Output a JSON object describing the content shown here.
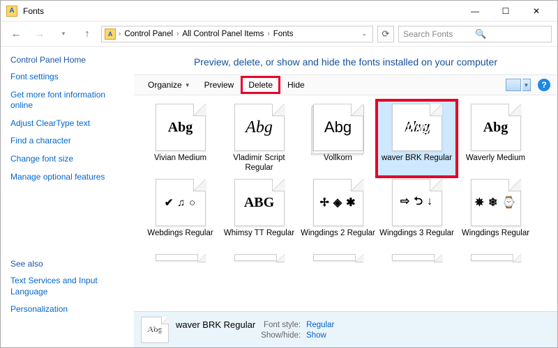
{
  "window": {
    "title": "Fonts"
  },
  "breadcrumb": {
    "items": [
      "Control Panel",
      "All Control Panel Items",
      "Fonts"
    ]
  },
  "search": {
    "placeholder": "Search Fonts"
  },
  "sidebar": {
    "home": "Control Panel Home",
    "links": [
      "Font settings",
      "Get more font information online",
      "Adjust ClearType text",
      "Find a character",
      "Change font size",
      "Manage optional features"
    ],
    "see_also_heading": "See also",
    "see_also": [
      "Text Services and Input Language",
      "Personalization"
    ]
  },
  "page_title": "Preview, delete, or show and hide the fonts installed on your computer",
  "toolbar": {
    "organize": "Organize",
    "preview": "Preview",
    "delete": "Delete",
    "hide": "Hide"
  },
  "fonts": [
    {
      "name": "Vivian Medium",
      "sample": "Abg",
      "style": "serif",
      "stack": false
    },
    {
      "name": "Vladimir Script Regular",
      "sample": "Abg",
      "style": "script",
      "stack": false
    },
    {
      "name": "Vollkorn",
      "sample": "Abg",
      "style": "sans",
      "stack": true
    },
    {
      "name": "waver BRK Regular",
      "sample": "Abg",
      "style": "zebra",
      "stack": false,
      "selected": true,
      "highlight": true
    },
    {
      "name": "Waverly Medium",
      "sample": "Abg",
      "style": "serif",
      "stack": false
    },
    {
      "name": "Webdings Regular",
      "sample": "✔ ♫ ○",
      "style": "symbols",
      "stack": false
    },
    {
      "name": "Whimsy TT Regular",
      "sample": "ABG",
      "style": "serif",
      "stack": false
    },
    {
      "name": "Wingdings 2 Regular",
      "sample": "✢ ◈ ✱",
      "style": "wing",
      "stack": false
    },
    {
      "name": "Wingdings 3 Regular",
      "sample": "⇨ ⮌ ↓",
      "style": "wing",
      "stack": false
    },
    {
      "name": "Wingdings Regular",
      "sample": "✵ ❄ ⌚",
      "style": "wing",
      "stack": false
    }
  ],
  "details": {
    "name": "waver BRK Regular",
    "labels": {
      "style": "Font style:",
      "showhide": "Show/hide:"
    },
    "values": {
      "style": "Regular",
      "showhide": "Show"
    },
    "thumb_sample": "Abg"
  }
}
